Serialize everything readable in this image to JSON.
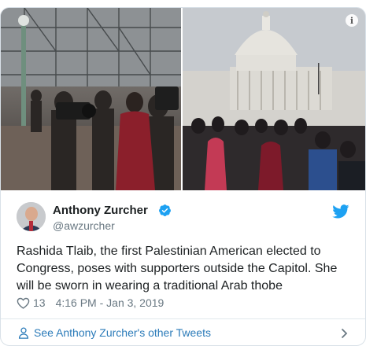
{
  "tweet": {
    "author_name": "Anthony Zurcher",
    "handle": "@awzurcher",
    "text": "Rashida Tlaib, the first Palestinian American elected to Congress, poses with supporters outside the Capitol. She will be sworn in wearing a traditional Arab thobe",
    "likes": "13",
    "timestamp": "4:16 PM - Jan 3, 2019"
  },
  "footer": {
    "link_label": "See Anthony Zurcher's other Tweets"
  },
  "media": {
    "info_glyph": "i"
  },
  "icons": {
    "verified": "verified-badge-icon",
    "twitter": "twitter-bird-icon",
    "like": "heart-icon",
    "person": "person-icon",
    "chevron": "chevron-right-icon",
    "info": "info-icon"
  },
  "colors": {
    "link": "#2b7bb9",
    "verified": "#1da1f2",
    "twitter": "#1da1f2",
    "meta_text": "#697882",
    "border": "#d9e1e8"
  }
}
